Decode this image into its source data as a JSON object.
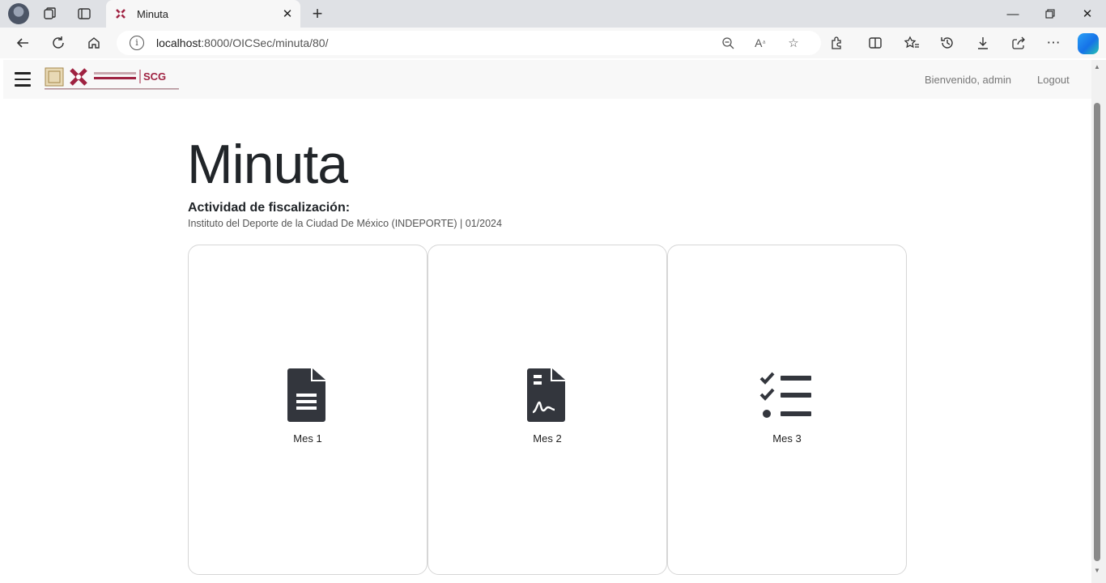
{
  "browser": {
    "tab_title": "Minuta",
    "url_host": "localhost",
    "url_path": ":8000/OICSec/minuta/80/"
  },
  "navbar": {
    "welcome": "Bienvenido,  admin",
    "logout": "Logout"
  },
  "main": {
    "title": "Minuta",
    "subtitle": "Actividad de fiscalización:",
    "detail": "Instituto del Deporte de la Ciudad De México (INDEPORTE) | 01/2024"
  },
  "cards": [
    {
      "label": "Mes 1",
      "icon": "file-lines-icon"
    },
    {
      "label": "Mes 2",
      "icon": "file-signature-icon"
    },
    {
      "label": "Mes 3",
      "icon": "list-check-icon"
    }
  ],
  "colors": {
    "icon": "#33363d",
    "brand": "#9f2241"
  }
}
